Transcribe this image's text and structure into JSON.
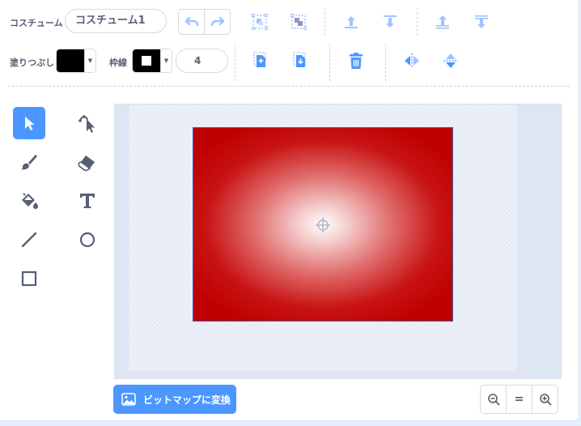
{
  "toolbar": {
    "costume_label": "コスチューム",
    "costume_name": "コスチューム1",
    "fill_label": "塗りつぶし",
    "outline_label": "枠線",
    "outline_width": "4",
    "fill_color": "#000000",
    "outline_color": "#000000"
  },
  "canvas": {
    "shape_colors": {
      "center": "#ffffff",
      "edge": "#bf0000"
    }
  },
  "bottom": {
    "convert_label": "ビットマップに変換",
    "zoom_reset_label": "="
  },
  "theme": {
    "accent": "#4c97ff",
    "icon": "#575e75"
  }
}
